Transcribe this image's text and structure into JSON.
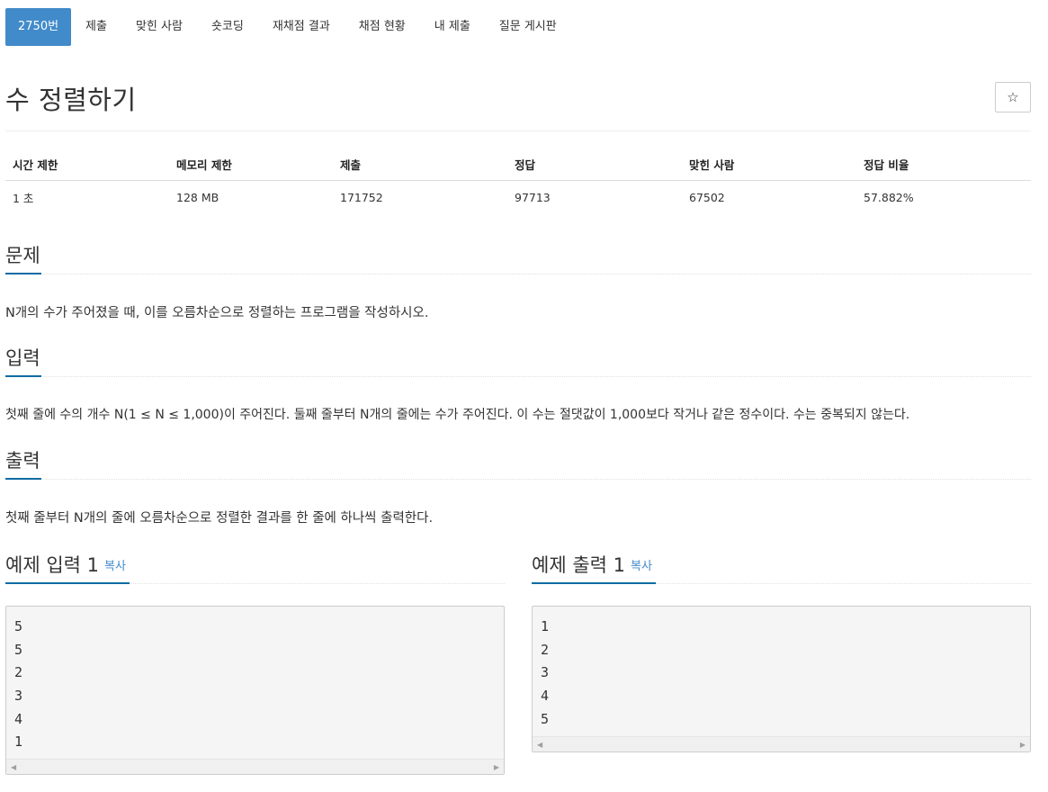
{
  "tabs": [
    {
      "label": "2750번",
      "active": true
    },
    {
      "label": "제출"
    },
    {
      "label": "맞힌 사람"
    },
    {
      "label": "숏코딩"
    },
    {
      "label": "재채점 결과"
    },
    {
      "label": "채점 현황"
    },
    {
      "label": "내 제출"
    },
    {
      "label": "질문 게시판"
    }
  ],
  "problem": {
    "title": "수 정렬하기",
    "star_icon": "☆"
  },
  "info": {
    "headers": [
      "시간 제한",
      "메모리 제한",
      "제출",
      "정답",
      "맞힌 사람",
      "정답 비율"
    ],
    "values": [
      "1 초",
      "128 MB",
      "171752",
      "97713",
      "67502",
      "57.882%"
    ]
  },
  "sections": {
    "problem_heading": "문제",
    "problem_text": "N개의 수가 주어졌을 때, 이를 오름차순으로 정렬하는 프로그램을 작성하시오.",
    "input_heading": "입력",
    "input_text": "첫째 줄에 수의 개수 N(1 ≤ N ≤ 1,000)이 주어진다. 둘째 줄부터 N개의 줄에는 수가 주어진다. 이 수는 절댓값이 1,000보다 작거나 같은 정수이다. 수는 중복되지 않는다.",
    "output_heading": "출력",
    "output_text": "첫째 줄부터 N개의 줄에 오름차순으로 정렬한 결과를 한 줄에 하나씩 출력한다."
  },
  "samples": {
    "input_heading": "예제 입력 1",
    "output_heading": "예제 출력 1",
    "copy_label": "복사",
    "input_lines": [
      "5",
      "5",
      "2",
      "3",
      "4",
      "1"
    ],
    "output_lines": [
      "1",
      "2",
      "3",
      "4",
      "5"
    ],
    "scroll_left": "◀",
    "scroll_right": "▶"
  },
  "colors": {
    "accent": "#428bca",
    "headline_underline": "#0e6ba3"
  }
}
